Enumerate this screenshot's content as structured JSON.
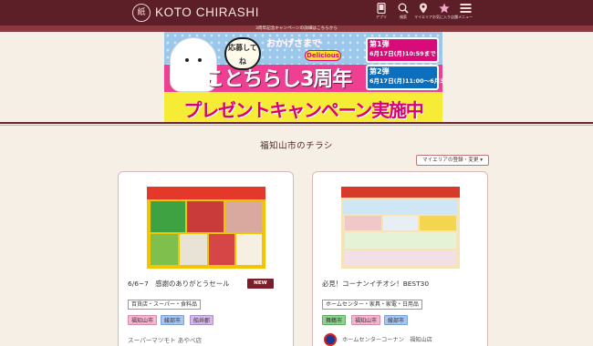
{
  "header": {
    "logo_text": "KOTO CHIRASHI",
    "logo_mark": "紙",
    "nav": [
      {
        "label": "アプリ",
        "icon": "app-phone-icon"
      },
      {
        "label": "検索",
        "icon": "search-icon"
      },
      {
        "label": "マイエリア",
        "icon": "map-pin-icon"
      },
      {
        "label": "お気に入り店舗",
        "icon": "star-icon"
      },
      {
        "label": "メニュー",
        "icon": "hamburger-menu-icon"
      }
    ]
  },
  "notice": "3周年記念キャンペーンの詳細はこちらから",
  "banner": {
    "bubble": "応募してね",
    "side_text": "おかげさまで",
    "gohan": "豪華",
    "headline": "ことちらし3周年",
    "delicious": "Delicious",
    "round1_label": "第1弾",
    "round1_date": "6月17日(月)10:59まで",
    "round2_label": "第2弾",
    "round2_date": "6月17日(月)11:00～6月30日(日)まで",
    "bottom": "プレゼントキャンペーン実施中"
  },
  "section_title": "福知山市のチラシ",
  "myarea_button": "マイエリアの登録・変更 ▾",
  "cards": [
    {
      "title": "6/6~7　感謝のありがとうセール",
      "badge": "NEW",
      "category": "百貨店・スーパー・食料品",
      "areas": [
        "福知山市",
        "綾部市",
        "船井郡"
      ],
      "store": "スーパーマツモト あやべ店"
    },
    {
      "title": "必見！コーナンイチオシ！BEST30",
      "category": "ホームセンター・家具・家電・日用品",
      "areas": [
        "舞鶴市",
        "福知山市",
        "綾部市"
      ],
      "store": "ホームセンターコーナン　福知山店"
    }
  ],
  "colors": {
    "header_bg": "#5c1f27",
    "page_bg": "#f6efe6",
    "badge_bg": "#7a1f2a",
    "area_green": "#8fd08f",
    "area_pink": "#f4b6d2",
    "area_blue": "#a9c6f0",
    "area_purple": "#d4b8e8"
  }
}
